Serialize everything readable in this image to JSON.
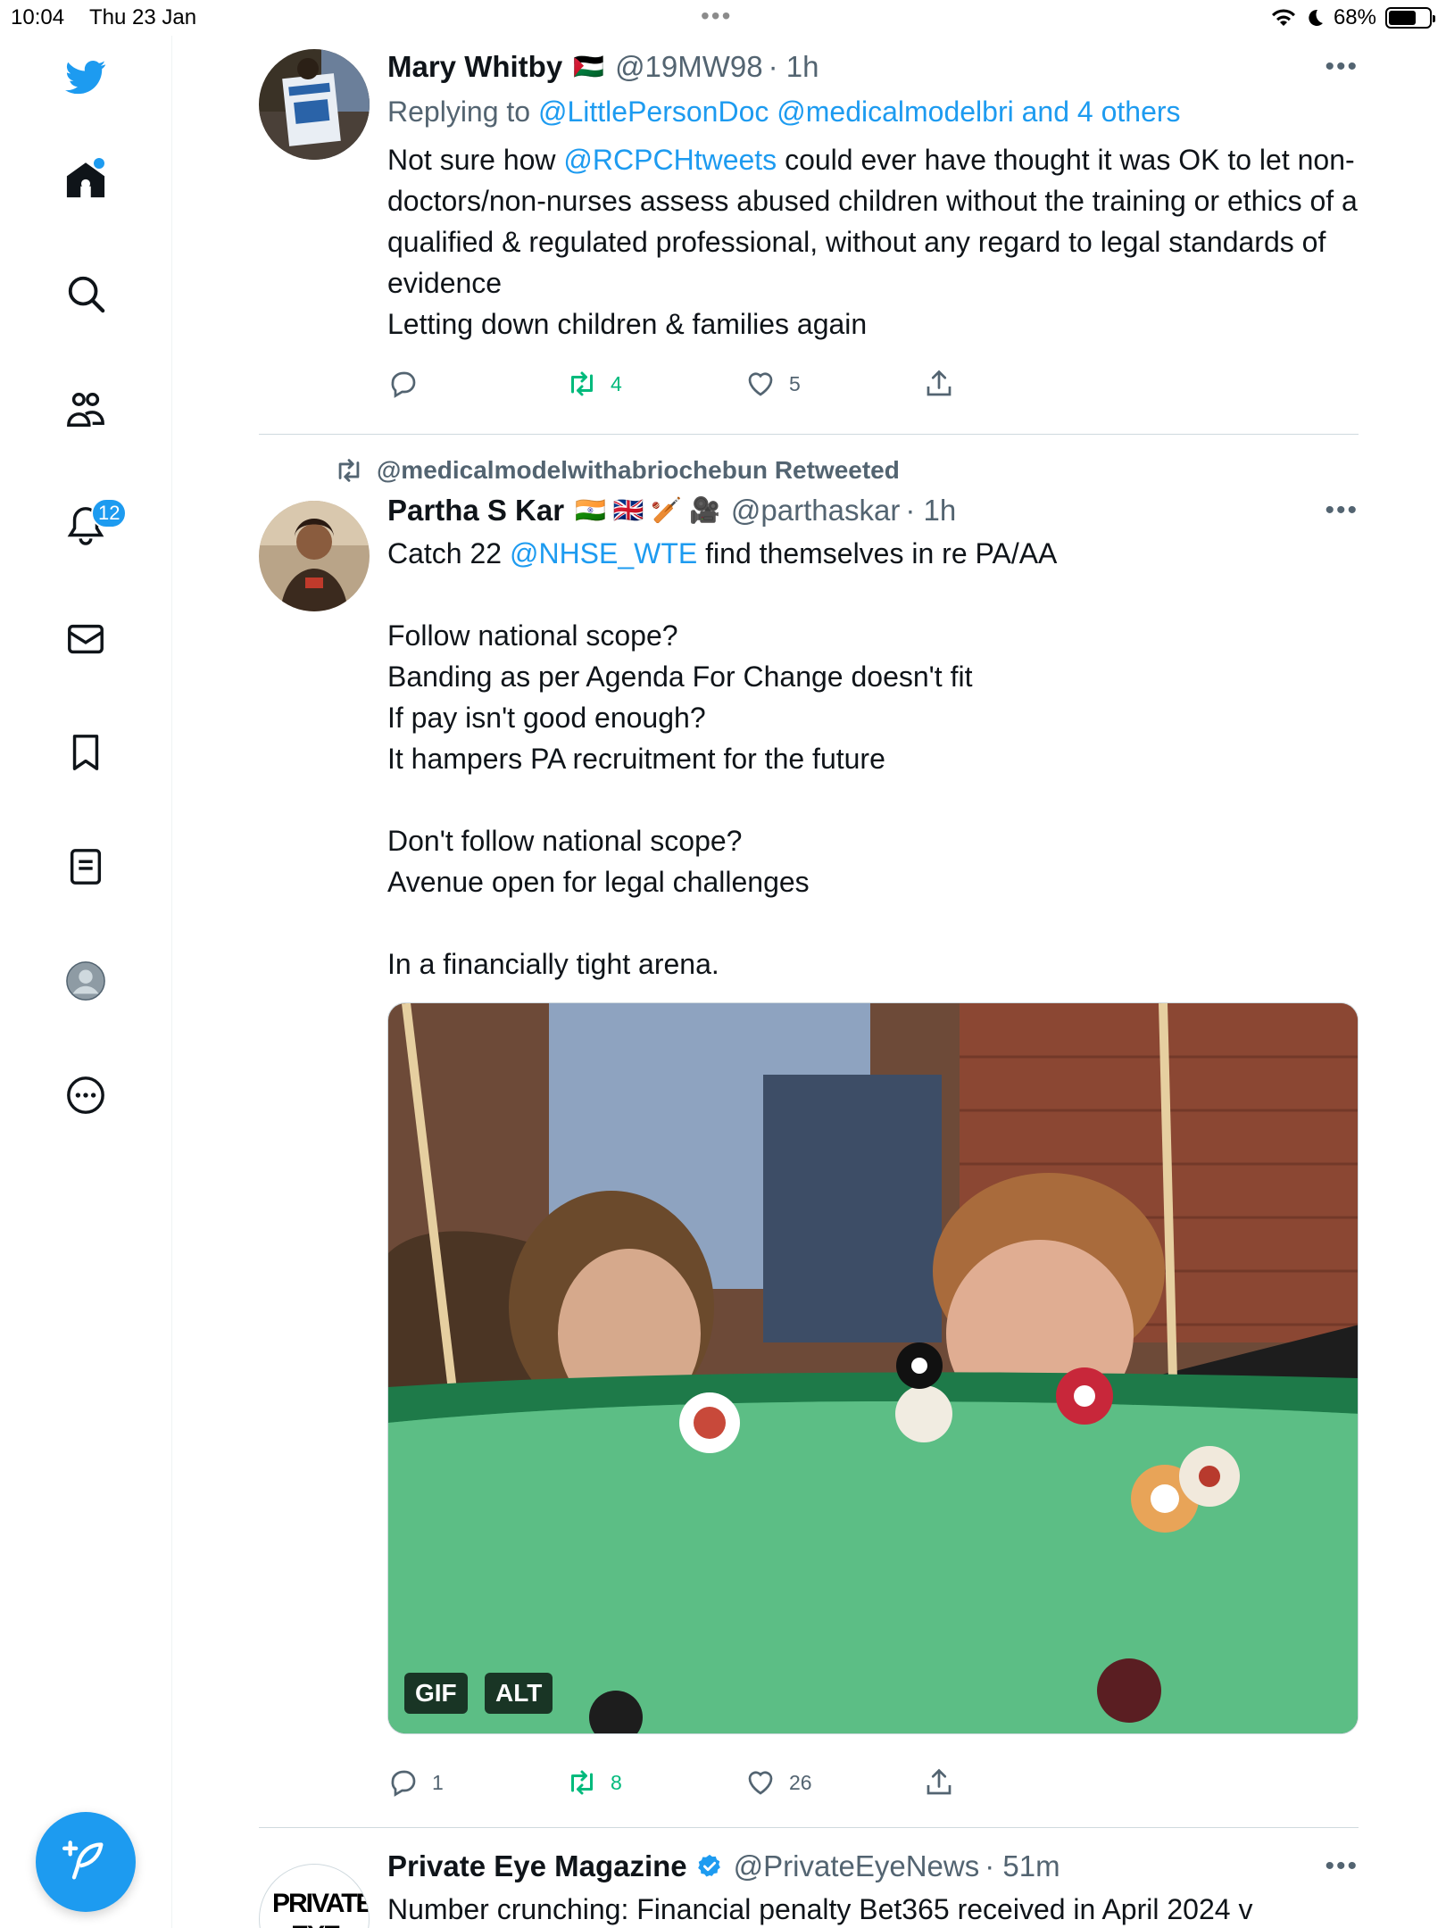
{
  "status_bar": {
    "time": "10:04",
    "date": "Thu 23 Jan",
    "battery": "68%",
    "battery_level": 0.68
  },
  "sidebar": {
    "notifications_badge": "12",
    "items": [
      "twitter-logo",
      "home-icon",
      "search-icon",
      "communities-icon",
      "notifications-icon",
      "messages-icon",
      "bookmarks-icon",
      "lists-icon",
      "profile-icon",
      "more-icon"
    ]
  },
  "tweets": [
    {
      "name": "Mary Whitby",
      "flag": "🇵🇸",
      "handle": "@19MW98",
      "time": "· 1h",
      "reply_prefix": "Replying to ",
      "reply_to": "@LittlePersonDoc @medicalmodelbri and 4 others",
      "body_pre": "Not sure how ",
      "body_mention": "@RCPCHtweets",
      "body_post": " could ever have thought it was OK to let non-doctors/non-nurses assess abused children without the training or ethics of a qualified & regulated professional, without any regard to legal standards of evidence\nLetting down children & families again",
      "replies": "",
      "retweets": "4",
      "likes": "5"
    },
    {
      "retweeted_by": "@medicalmodelwithabriochebun Retweeted",
      "name": "Partha S Kar",
      "flag": "🇮🇳 🇬🇧 🏏 🎥",
      "handle": "@parthaskar",
      "time": "· 1h",
      "body_pre": "Catch 22 ",
      "body_mention": "@NHSE_WTE",
      "body_post": "  find themselves in re PA/AA\n\nFollow national scope?\nBanding as per Agenda For Change doesn't fit\nIf pay isn't good enough?\nIt hampers PA recruitment for the future\n\nDon't follow national scope?\nAvenue open for legal challenges\n\nIn a financially tight arena.",
      "media_gif": "GIF",
      "media_alt": "ALT",
      "replies": "1",
      "retweets": "8",
      "likes": "26"
    },
    {
      "name": "Private Eye Magazine",
      "handle": "@PrivateEyeNews",
      "time": "· 51m",
      "avatar_text": "PRIVATE EYE",
      "body": "Number crunching: Financial penalty Bet365 received in April 2024 v"
    }
  ],
  "colors": {
    "accent": "#1d9bf0",
    "retweet_green": "#00ba7c",
    "secondary_text": "#536471"
  }
}
